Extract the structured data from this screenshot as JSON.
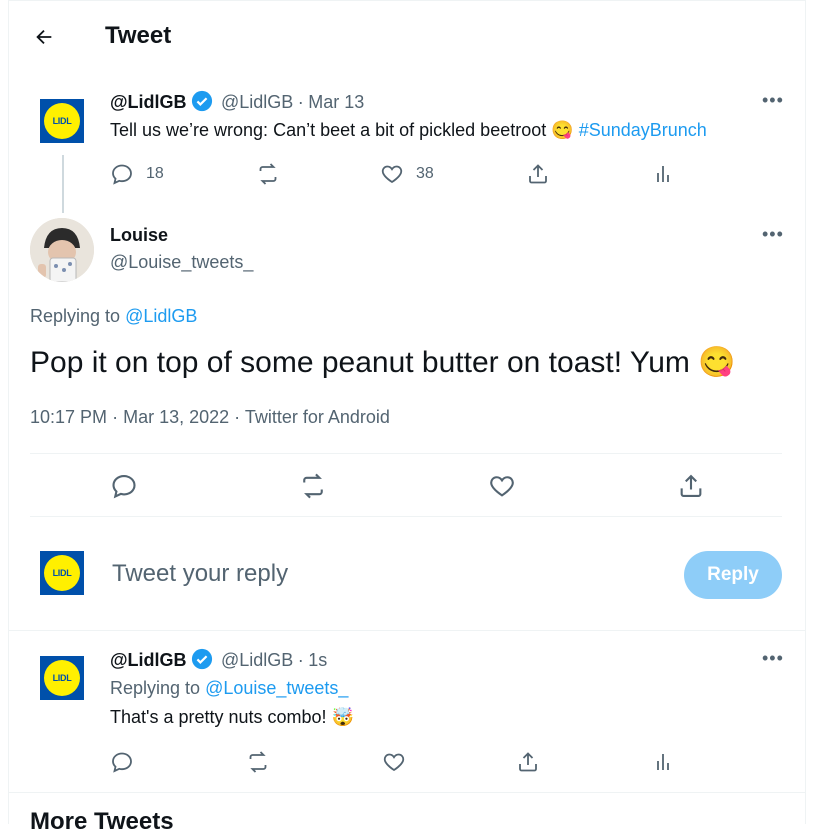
{
  "header": {
    "title": "Tweet"
  },
  "parent_tweet": {
    "name": "@LidlGB",
    "handle": "@LidlGB",
    "sep": "·",
    "time": "Mar 13",
    "text": "Tell us we’re wrong: Can’t beet a bit of pickled beetroot",
    "emoji": "😋",
    "hashtag": "#SundayBrunch",
    "more": "•••",
    "reply_count": "18",
    "like_count": "38"
  },
  "main_tweet": {
    "name": "Louise",
    "handle": "@Louise_tweets_",
    "more": "•••",
    "replying_prefix": "Replying to",
    "replying_to": "@LidlGB",
    "text": "Pop it on top of some peanut butter on toast! Yum",
    "emoji": "😋",
    "time": "10:17 PM",
    "date": "Mar 13, 2022",
    "source": "Twitter for Android",
    "dot": "·"
  },
  "compose": {
    "placeholder": "Tweet your reply",
    "reply_label": "Reply"
  },
  "reply_tweet": {
    "name": "@LidlGB",
    "handle": "@LidlGB",
    "sep": "·",
    "time": "1s",
    "more": "•••",
    "replying_prefix": "Replying to",
    "replying_to": "@Louise_tweets_",
    "text": "That's a pretty nuts combo!",
    "emoji": "🤯"
  },
  "more_tweets": {
    "title": "More Tweets"
  },
  "brand": {
    "logo_text": "LIDL"
  },
  "colors": {
    "accent": "#1d9bf0",
    "reply_button": "#8ecdf8",
    "muted": "#536471",
    "lidl_blue": "#0050aa",
    "lidl_yellow": "#fff000"
  }
}
